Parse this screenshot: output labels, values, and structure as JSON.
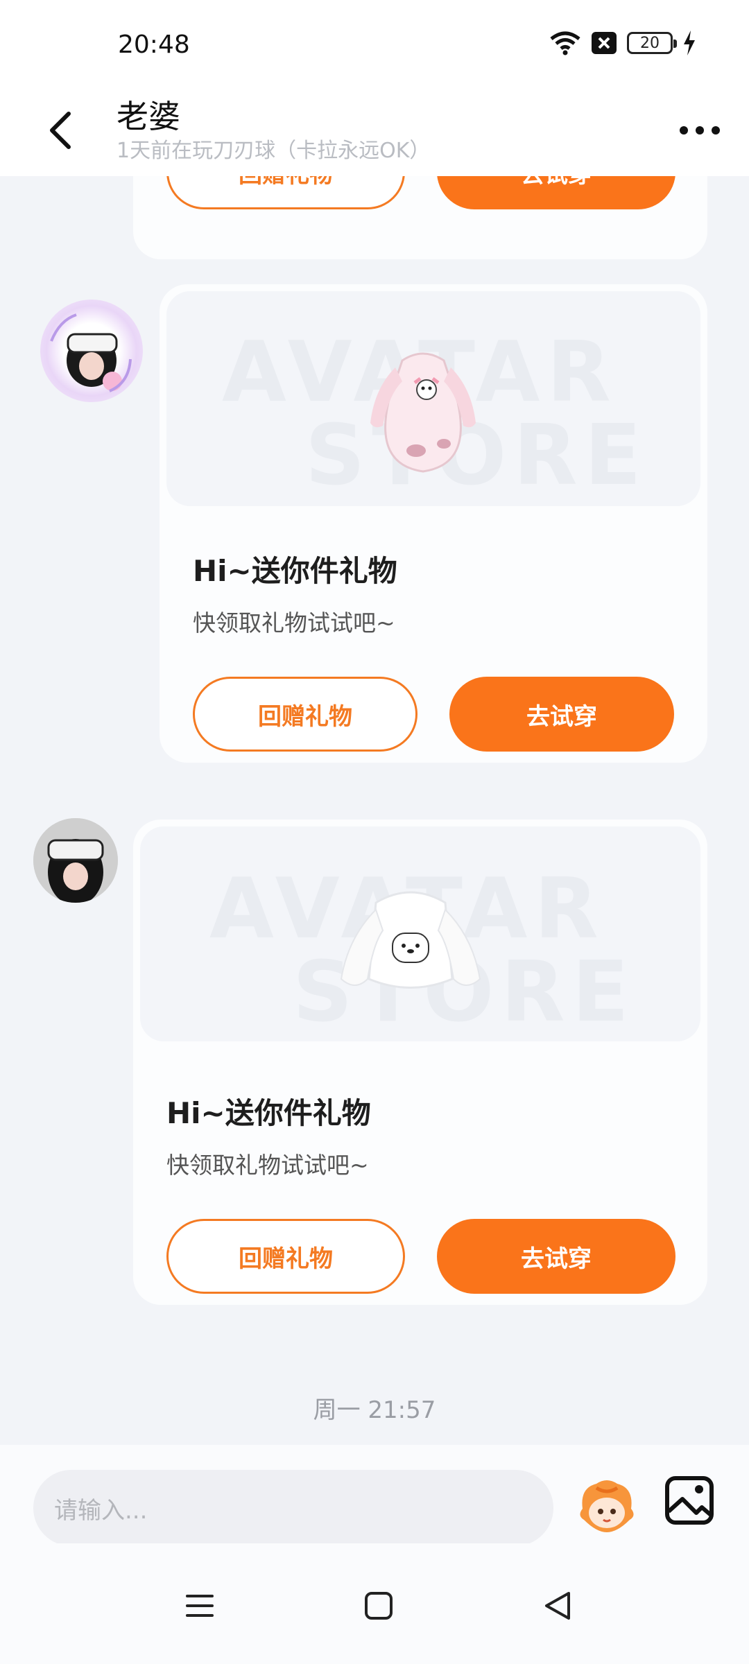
{
  "status_bar": {
    "time": "20:48",
    "battery": "20"
  },
  "header": {
    "title": "老婆",
    "subtitle": "1天前在玩刀刃球（卡拉永远OK）"
  },
  "messages": [
    {
      "outline_label": "回赠礼物",
      "primary_label": "去试穿"
    },
    {
      "image_watermark_top": "AVATAR",
      "image_watermark_bottom": "STORE",
      "heading": "Hi~送你件礼物",
      "desc": "快领取礼物试试吧~",
      "outline_label": "回赠礼物",
      "primary_label": "去试穿"
    },
    {
      "image_watermark_top": "AVATAR",
      "image_watermark_bottom": "STORE",
      "heading": "Hi~送你件礼物",
      "desc": "快领取礼物试试吧~",
      "outline_label": "回赠礼物",
      "primary_label": "去试穿"
    }
  ],
  "timestamp": "周一 21:57",
  "input": {
    "placeholder": "请输入..."
  },
  "colors": {
    "accent": "#fa741a",
    "background": "#f2f4f8"
  }
}
